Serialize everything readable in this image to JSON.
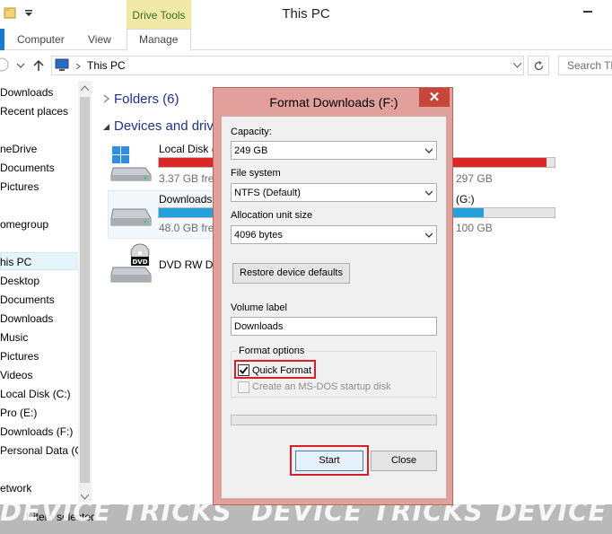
{
  "window": {
    "title": "This PC"
  },
  "ribbon": {
    "context_group": "Drive Tools",
    "tabs": [
      "Computer",
      "View",
      "Manage"
    ]
  },
  "address": {
    "path": "This PC",
    "search_placeholder": "Search Th"
  },
  "nav_pane": {
    "items": [
      {
        "label": "Downloads"
      },
      {
        "label": "Recent places"
      },
      {
        "label": "neDrive"
      },
      {
        "label": "Documents"
      },
      {
        "label": "Pictures"
      },
      {
        "label": "omegroup"
      },
      {
        "label": "his PC"
      },
      {
        "label": "Desktop"
      },
      {
        "label": "Documents"
      },
      {
        "label": "Downloads"
      },
      {
        "label": "Music"
      },
      {
        "label": "Pictures"
      },
      {
        "label": "Videos"
      },
      {
        "label": "Local Disk (C:)"
      },
      {
        "label": "Pro (E:)"
      },
      {
        "label": "Downloads (F:)"
      },
      {
        "label": "Personal Data (G"
      },
      {
        "label": "etwork"
      }
    ]
  },
  "content": {
    "folders_header": "Folders (6)",
    "devices_header": "Devices and drive",
    "drives": [
      {
        "name": "Local Disk (",
        "free": "3.37 GB free",
        "free_right": "297 GB",
        "fill": 0.98,
        "color": "#da2626"
      },
      {
        "name": "Downloads",
        "free": "48.0 GB free",
        "name_right": "(G:)",
        "free_right": "100 GB",
        "fill": 0.82,
        "color": "#26a0da"
      },
      {
        "name": "DVD RW Dri"
      }
    ]
  },
  "status": {
    "text": "1 item selected"
  },
  "watermark": {
    "parts": [
      "DEVICE TRICKS",
      "DEVICE TRICKS",
      "DEVICE"
    ]
  },
  "dialog": {
    "title": "Format Downloads (F:)",
    "close_glyph": "✕",
    "capacity_label": "Capacity:",
    "capacity_value": "249 GB",
    "filesystem_label": "File system",
    "filesystem_value": "NTFS (Default)",
    "allocation_label": "Allocation unit size",
    "allocation_value": "4096 bytes",
    "restore_button": "Restore device defaults",
    "volume_label": "Volume label",
    "volume_value": "Downloads",
    "format_options_label": "Format options",
    "quick_format_label": "Quick Format",
    "quick_format_checked": true,
    "msdos_label": "Create an MS-DOS startup disk",
    "msdos_checked": false,
    "start_button": "Start",
    "close_button": "Close",
    "progress": 0
  }
}
